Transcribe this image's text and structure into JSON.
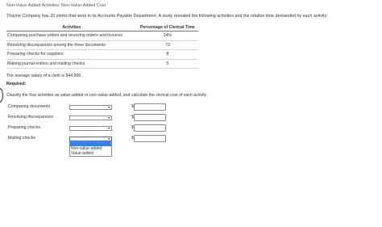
{
  "title": "Non-Value-Added Activities; Non-Value-Added Cost",
  "intro": "Thayne Company has 20 clerks that work in its Accounts Payable Department. A study revealed the following activities and the relative time demanded by each activity:",
  "table": {
    "headers": [
      "Activities",
      "Percentage of Clerical Time"
    ],
    "rows": [
      {
        "activity": "Comparing purchase orders and receiving orders and invoices",
        "pct": "14%"
      },
      {
        "activity": "Resolving discrepancies among the three documents",
        "pct": "73"
      },
      {
        "activity": "Preparing checks for suppliers",
        "pct": "8"
      },
      {
        "activity": "Making journal entries and mailing checks",
        "pct": "5"
      }
    ]
  },
  "salary_note": "The average salary of a clerk is $44,900.",
  "required_label": "Required:",
  "instruction": "Classify the four activities as value-added or non-value-added, and calculate the clerical cost of each activity.",
  "answer_rows": [
    {
      "label": "Comparing documents",
      "currency": "$",
      "value": ""
    },
    {
      "label": "Resolving discrepancies",
      "currency": "$",
      "value": ""
    },
    {
      "label": "Preparing checks",
      "currency": "$",
      "value": ""
    },
    {
      "label": "Mailing checks",
      "currency": "$",
      "value": ""
    }
  ],
  "dropdown_options": [
    "Non-value-added",
    "Value-added"
  ],
  "icons": {
    "select_arrow": "chevron-down-icon"
  }
}
